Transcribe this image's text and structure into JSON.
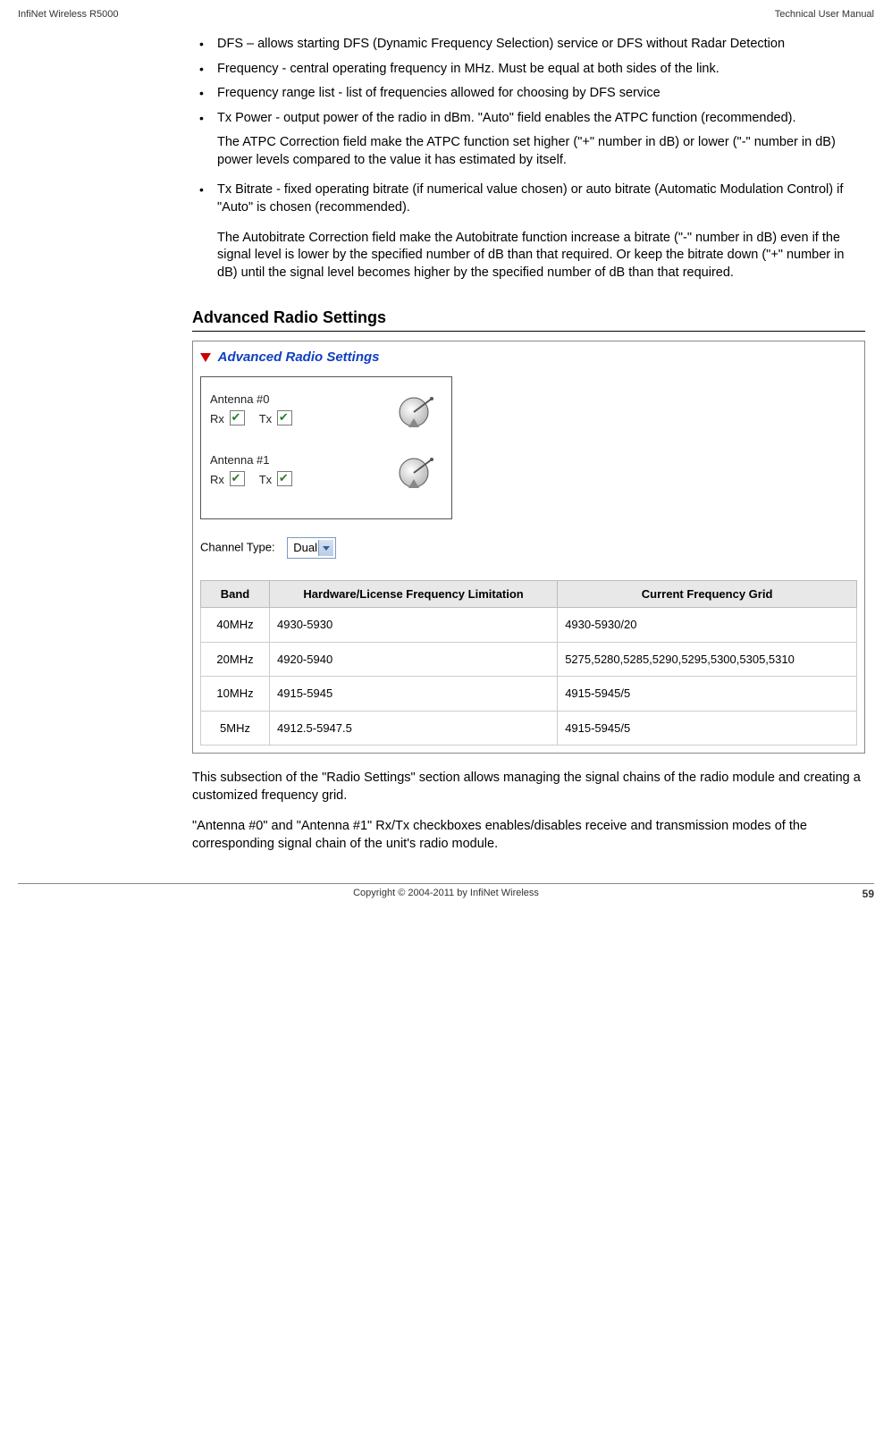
{
  "header": {
    "left": "InfiNet Wireless R5000",
    "right": "Technical User Manual"
  },
  "bullets": {
    "dfs": "DFS – allows starting DFS (Dynamic Frequency Selection) service or DFS without Radar Detection",
    "freq": "Frequency - central operating frequency in MHz. Must be equal at both sides of the link.",
    "freqrange": "Frequency range list - list of frequencies allowed for choosing by DFS service",
    "txpower": "Tx Power - output power of the radio in dBm. \"Auto\" field enables the ATPC function (recommended).",
    "txpower_sub": "The ATPC Correction field make the ATPC function set higher (\"+\" number in dB) or lower (\"-\" number in dB) power levels compared to the value it has estimated by itself.",
    "txbitrate": "Tx Bitrate - fixed operating bitrate (if numerical value chosen) or auto bitrate (Automatic Modulation Control) if \"Auto\" is chosen (recommended).",
    "txbitrate_sub": "The Autobitrate Correction field make the Autobitrate function increase a bitrate (\"-\" number in dB) even if the signal level is lower by the specified number of dB than that required. Or keep the bitrate down (\"+\" number in dB) until the signal level becomes higher by the specified number of dB than that required."
  },
  "section_title": "Advanced Radio Settings",
  "screenshot": {
    "title": "Advanced Radio Settings",
    "antenna0": {
      "label": "Antenna #0",
      "rx": "Rx",
      "tx": "Tx"
    },
    "antenna1": {
      "label": "Antenna #1",
      "rx": "Rx",
      "tx": "Tx"
    },
    "channel_label": "Channel Type:",
    "channel_value": "Dual",
    "table": {
      "h_band": "Band",
      "h_hw": "Hardware/License Frequency Limitation",
      "h_grid": "Current Frequency Grid",
      "rows": [
        {
          "band": "40MHz",
          "hw": "4930-5930",
          "grid": "4930-5930/20"
        },
        {
          "band": "20MHz",
          "hw": "4920-5940",
          "grid": "5275,5280,5285,5290,5295,5300,5305,5310"
        },
        {
          "band": "10MHz",
          "hw": "4915-5945",
          "grid": "4915-5945/5"
        },
        {
          "band": "5MHz",
          "hw": "4912.5-5947.5",
          "grid": "4915-5945/5"
        }
      ]
    }
  },
  "after_shot_1": "This subsection of the \"Radio Settings\" section allows managing the signal chains of the radio module and creating a customized frequency grid.",
  "after_shot_2": "\"Antenna #0\" and \"Antenna #1\" Rx/Tx checkboxes enables/disables receive and transmission modes of the corresponding signal chain of the unit's radio module.",
  "footer": {
    "copyright": "Copyright © 2004-2011 by InfiNet Wireless",
    "page": "59"
  }
}
